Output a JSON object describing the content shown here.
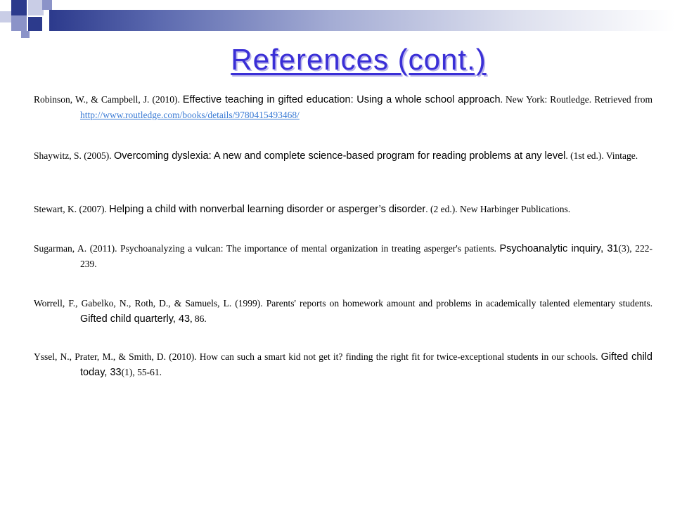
{
  "title": "References (cont.)",
  "colors": {
    "title": "#3a2fd6",
    "link": "#3a7bd5",
    "band": "#2c3a8c"
  },
  "references": [
    {
      "authors": "Robinson, W., & Campbell, J. (2010). ",
      "title": "Effective teaching in gifted education: Using a whole school approach",
      "rest": ". New York: Routledge. Retrieved from ",
      "link": "http://www.routledge.com/books/details/9780415493468/"
    },
    {
      "authors": "Shaywitz, S. (2005). ",
      "title": "Overcoming dyslexia: A new and complete science-based program for reading problems at any level",
      "rest": ". (1st ed.). Vintage."
    },
    {
      "authors": "Stewart, K. (2007). ",
      "title": "Helping a child with nonverbal learning disorder or asperger’s disorder",
      "rest": ". (2 ed.). New Harbinger Publications."
    },
    {
      "authors": "Sugarman, A. (2011). Psychoanalyzing a vulcan: The importance of mental organization in treating asperger's patients. ",
      "journal": "Psychoanalytic inquiry, 31",
      "rest": "(3), 222-239."
    },
    {
      "authors": "Worrell, F., Gabelko, N., Roth, D., & Samuels, L. (1999). Parents' reports on homework amount and problems in academically talented elementary students. ",
      "journal": "Gifted child quarterly, 43",
      "rest": ", 86."
    },
    {
      "authors": "Yssel, N., Prater, M., & Smith, D. (2010). How can such a smart kid not get it? finding the right fit for twice-exceptional students in our schools. ",
      "journal": "Gifted child today, 33",
      "rest": "(1), 55-61."
    }
  ]
}
